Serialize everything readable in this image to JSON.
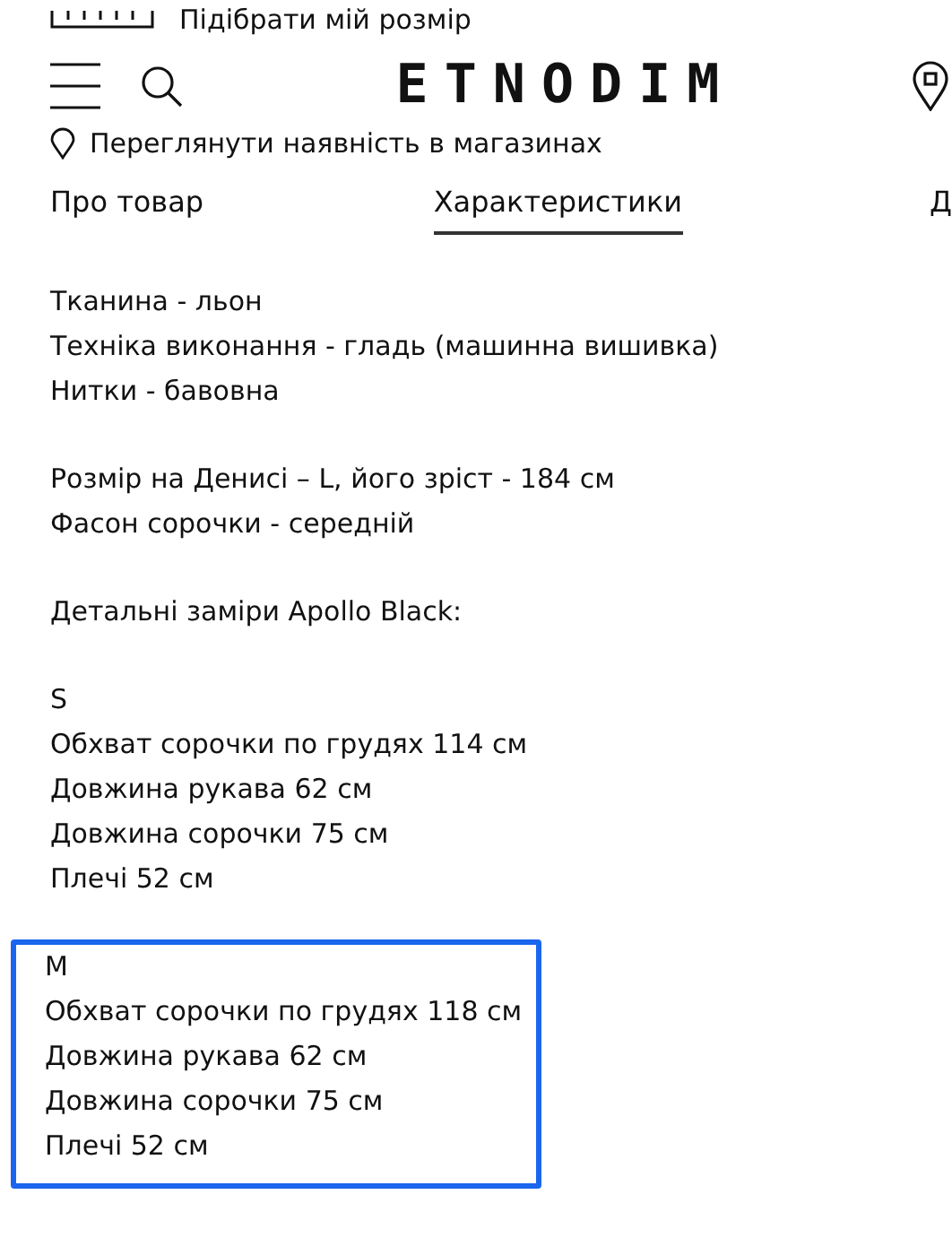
{
  "size_link": {
    "label": "Підібрати мій розмір"
  },
  "header": {
    "logo": "ETNODIM"
  },
  "store_link": {
    "label": "Переглянути наявність в магазинах"
  },
  "tabs": [
    {
      "label": "Про товар",
      "selected": false
    },
    {
      "label": "Характеристики",
      "selected": true
    },
    {
      "label": "Д",
      "selected": false
    }
  ],
  "paragraphs": [
    {
      "lines": [
        "Тканина - льон",
        "Техніка виконання - гладь (машинна вишивка)",
        "Нитки - бавовна"
      ],
      "highlighted": false
    },
    {
      "lines": [
        "Розмір на Денисі – L, його зріст - 184 см",
        "Фасон сорочки - середній"
      ],
      "highlighted": false
    },
    {
      "lines": [
        "Детальні заміри Apollo Black:"
      ],
      "highlighted": false
    },
    {
      "lines": [
        "S",
        "Обхват сорочки по грудях 114 см",
        "Довжина рукава 62 см",
        "Довжина сорочки 75 см",
        "Плечі 52 см"
      ],
      "highlighted": false
    },
    {
      "lines": [
        "M",
        "Обхват сорочки по грудях 118 см",
        "Довжина рукава 62 см",
        "Довжина сорочки 75 см",
        "Плечі 52 см"
      ],
      "highlighted": true
    }
  ]
}
